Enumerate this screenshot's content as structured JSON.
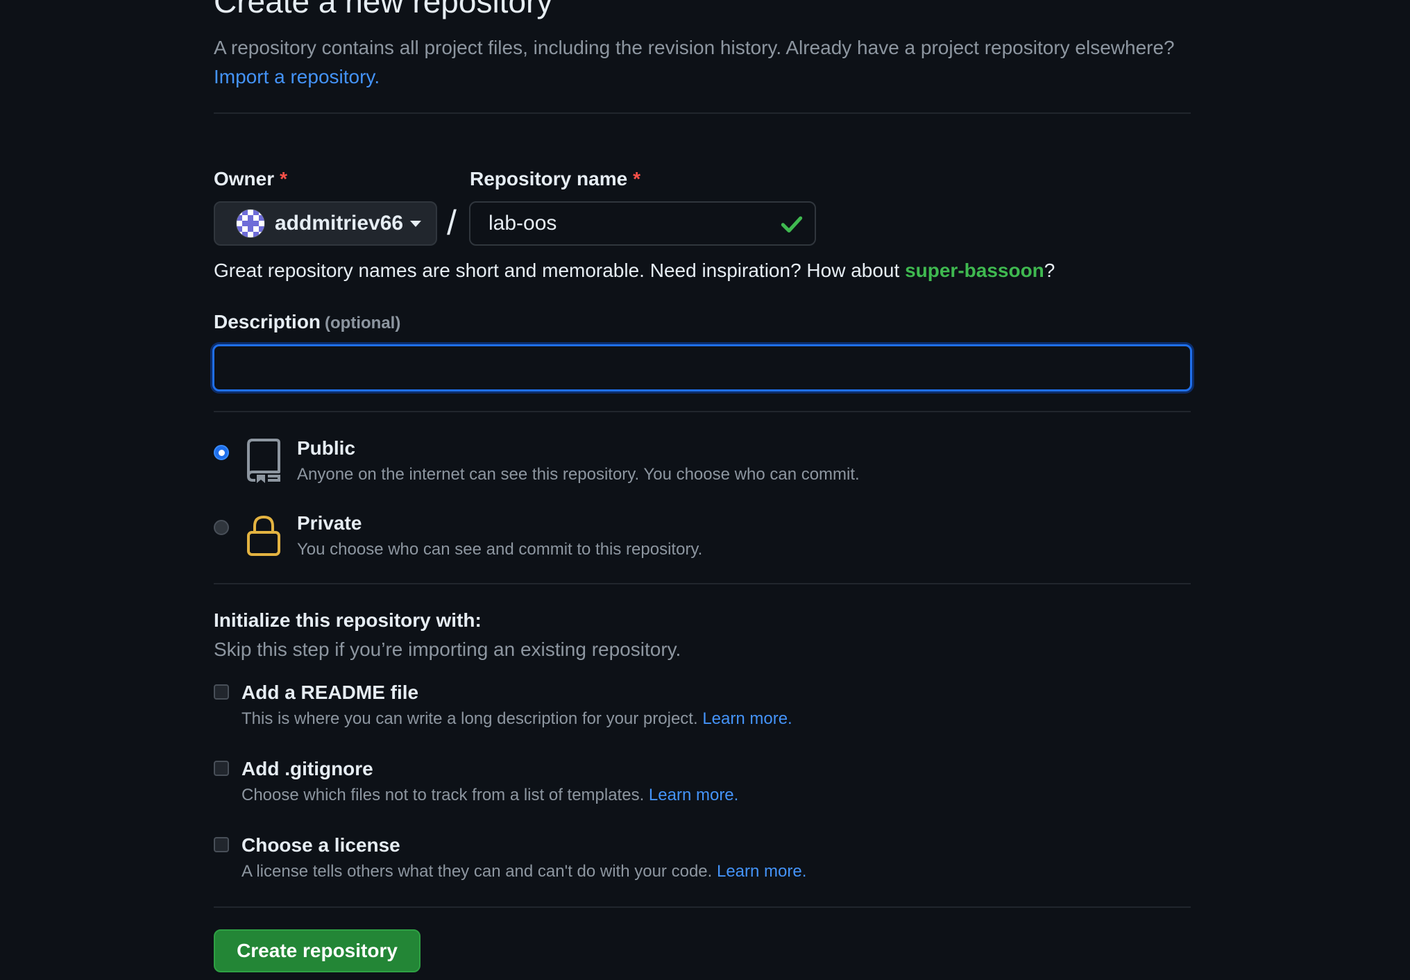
{
  "page": {
    "title": "Create a new repository",
    "intro": "A repository contains all project files, including the revision history. Already have a project repository elsewhere?",
    "import_link": "Import a repository."
  },
  "owner": {
    "label": "Owner",
    "required_mark": "*",
    "value": "addmitriev66"
  },
  "separator": "/",
  "repo_name": {
    "label": "Repository name",
    "required_mark": "*",
    "value": "lab-oos",
    "valid_icon": "check-icon"
  },
  "hint": {
    "text": "Great repository names are short and memorable. Need inspiration? How about",
    "suggestion": "super-bassoon",
    "suffix": "?"
  },
  "description": {
    "label": "Description",
    "optional": "(optional)",
    "value": "",
    "placeholder": ""
  },
  "visibility": {
    "selected": "public",
    "options": [
      {
        "id": "public",
        "title": "Public",
        "desc": "Anyone on the internet can see this repository. You choose who can commit.",
        "icon": "repo-icon"
      },
      {
        "id": "private",
        "title": "Private",
        "desc": "You choose who can see and commit to this repository.",
        "icon": "lock-icon"
      }
    ]
  },
  "init": {
    "title": "Initialize this repository with:",
    "subtitle": "Skip this step if you’re importing an existing repository.",
    "options": [
      {
        "title": "Add a README file",
        "desc": "This is where you can write a long description for your project.",
        "link": "Learn more.",
        "checked": false
      },
      {
        "title": "Add .gitignore",
        "desc": "Choose which files not to track from a list of templates.",
        "link": "Learn more.",
        "checked": false
      },
      {
        "title": "Choose a license",
        "desc": "A license tells others what they can and can't do with your code.",
        "link": "Learn more.",
        "checked": false
      }
    ]
  },
  "submit": {
    "label": "Create repository"
  },
  "colors": {
    "background": "#0d1117",
    "link": "#4493f8",
    "success": "#3fb950",
    "primary_button": "#238636",
    "focus_ring": "#1f6feb",
    "lock": "#e3b341",
    "required": "#f85149"
  }
}
